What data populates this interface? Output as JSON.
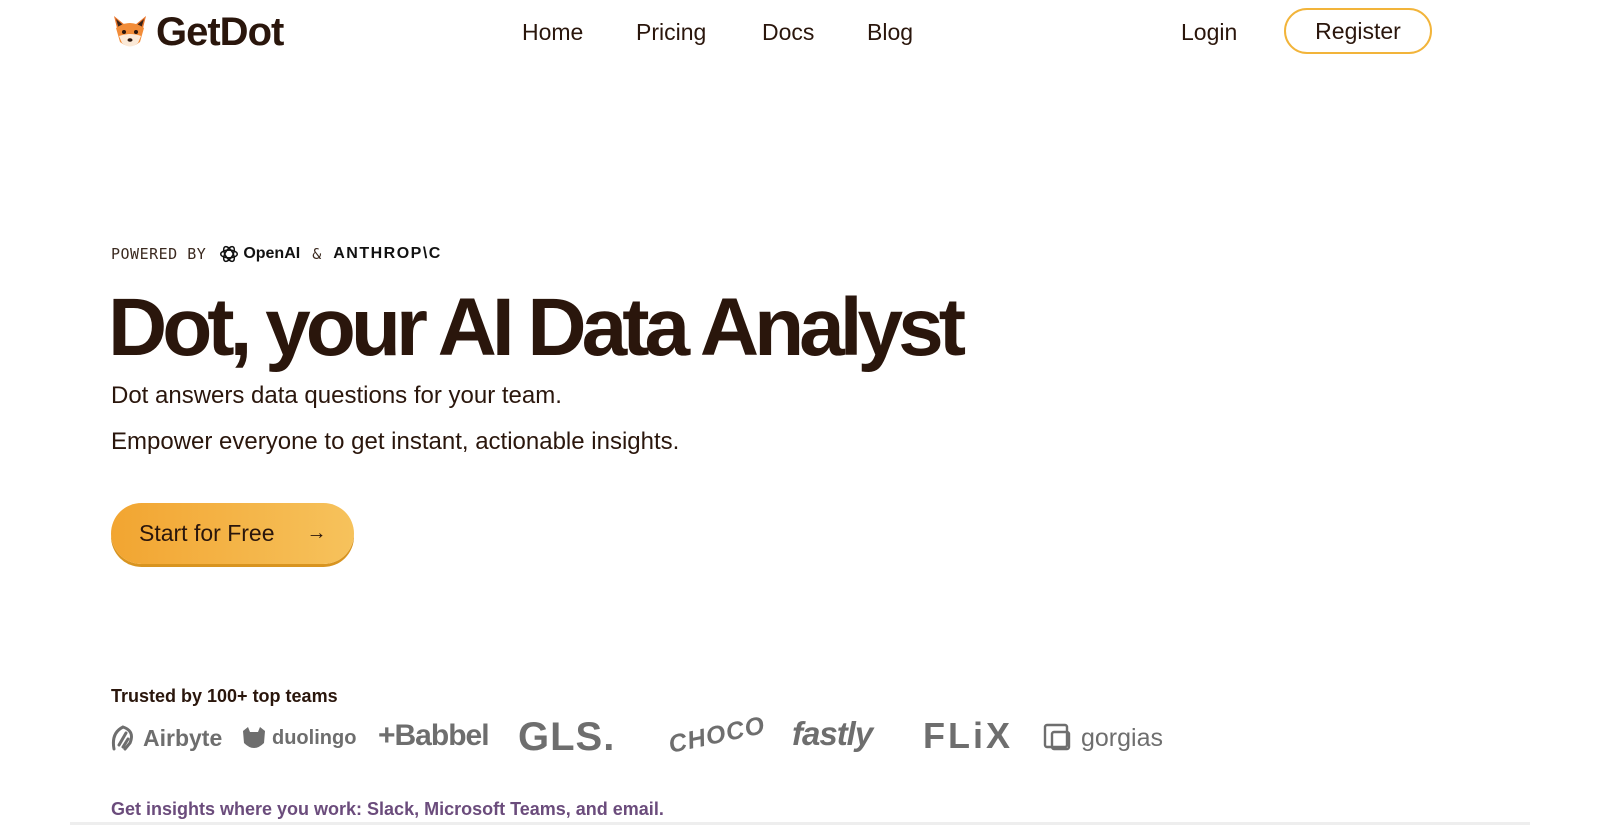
{
  "brand": {
    "name": "GetDot",
    "icon": "fox-face-icon"
  },
  "nav": {
    "home": "Home",
    "pricing": "Pricing",
    "docs": "Docs",
    "blog": "Blog"
  },
  "auth": {
    "login": "Login",
    "register": "Register"
  },
  "hero": {
    "powered_by": "POWERED BY",
    "openai": "OpenAI",
    "amp": "&",
    "anthropic": "ANTHROP\\C",
    "headline": "Dot, your AI Data Analyst",
    "subline_1": "Dot answers data questions for your team.",
    "subline_2": "Empower everyone to get instant, actionable insights.",
    "cta_label": "Start for Free",
    "cta_arrow": "→"
  },
  "trusted": {
    "title": "Trusted by 100+ top teams",
    "logos": [
      "Airbyte",
      "duolingo",
      "+Babbel",
      "GLS.",
      "CHOCO",
      "fastly",
      "FLiX",
      "gorgias"
    ]
  },
  "footer": {
    "integrations_text": "Get insights where you work: Slack, Microsoft Teams, and email."
  },
  "colors": {
    "text": "#2a160c",
    "accent": "#f2a531",
    "register_border": "#f2b43a",
    "logo_gray": "#6e6e6e",
    "footer_purple": "#6b4c7c"
  }
}
